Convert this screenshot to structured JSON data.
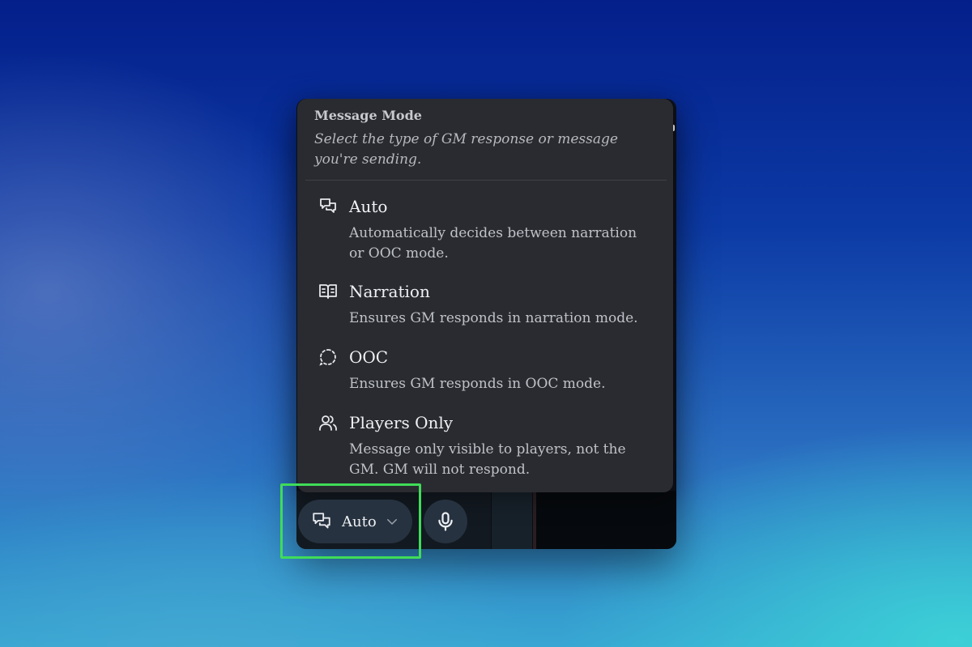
{
  "popup": {
    "title": "Message Mode",
    "subtitle": "Select the type of GM response or message you're sending.",
    "options": [
      {
        "icon": "chat-bubbles-icon",
        "title": "Auto",
        "description": "Automatically decides between narration or OOC mode."
      },
      {
        "icon": "open-book-icon",
        "title": "Narration",
        "description": "Ensures GM responds in narration mode."
      },
      {
        "icon": "dashed-bubble-icon",
        "title": "OOC",
        "description": "Ensures GM responds in OOC mode."
      },
      {
        "icon": "users-icon",
        "title": "Players Only",
        "description": "Message only visible to players, not the GM. GM will not respond."
      }
    ]
  },
  "controls": {
    "mode_label": "Auto",
    "mode_icon": "chat-bubbles-icon",
    "mic_icon": "microphone-icon"
  },
  "colors": {
    "highlight": "#3fdc58",
    "popup_bg": "#2a2b30",
    "button_bg": "#263240"
  }
}
